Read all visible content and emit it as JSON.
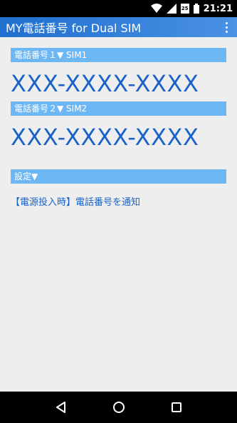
{
  "status_bar": {
    "time": "21:21",
    "sim_badge": "25"
  },
  "app_bar": {
    "title": "MY電話番号 for Dual SIM"
  },
  "sim1": {
    "header": "電話番号１▼ SIM1",
    "number": "XXX-XXXX-XXXX"
  },
  "sim2": {
    "header": "電話番号２▼ SIM2",
    "number": "XXX-XXXX-XXXX"
  },
  "settings": {
    "header": "設定▼",
    "option_label": "【電源投入時】電話番号を通知"
  },
  "colors": {
    "accent": "#1a62c8",
    "header_bg": "#6db7f5",
    "app_bar": "#2a7ad8"
  }
}
